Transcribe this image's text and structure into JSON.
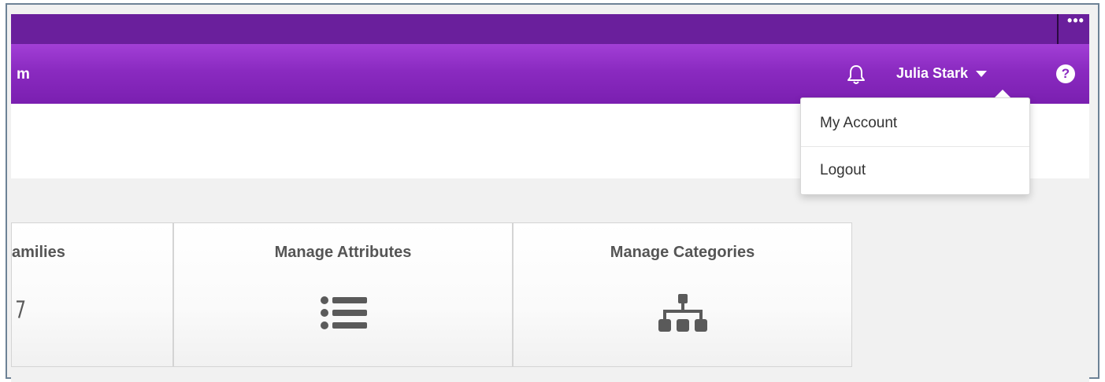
{
  "topbar": {
    "more_label": "•••"
  },
  "navbar": {
    "title_fragment": "m",
    "user_name": "Julia Stark",
    "help_label": "?"
  },
  "user_dropdown": {
    "items": [
      {
        "label": "My Account"
      },
      {
        "label": "Logout"
      }
    ]
  },
  "tiles": [
    {
      "label": "amilies",
      "icon": "tag-icon"
    },
    {
      "label": "Manage Attributes",
      "icon": "list-icon"
    },
    {
      "label": "Manage Categories",
      "icon": "sitemap-icon"
    }
  ],
  "colors": {
    "topbar": "#6a1f9c",
    "navbar": "#8a2ac0",
    "tile_text": "#555555",
    "icon": "#5a5a5a"
  }
}
